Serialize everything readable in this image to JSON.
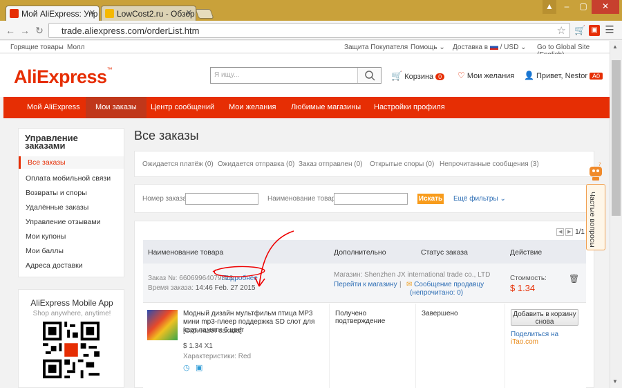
{
  "browser": {
    "tabs": [
      {
        "title": "Мой AliExpress: Упр",
        "icon_color": "#e62e04"
      },
      {
        "title": "LowCost2.ru - Обзор",
        "icon_color": "#f5b800"
      }
    ],
    "url": "trade.aliexpress.com/orderList.htm",
    "window_controls": [
      "–",
      "▢",
      "✕"
    ]
  },
  "topstrip": {
    "hot": "Горящие товары",
    "mall": "Молл",
    "protection": "Защита Покупателя",
    "help": "Помощь",
    "ship_to": "Доставка в",
    "currency": "USD",
    "global_site": "Go to Global Site (English)"
  },
  "header": {
    "logo": "AliExpress",
    "search_placeholder": "Я ищу...",
    "cart_label": "Корзина",
    "cart_count": "0",
    "wishlist_label": "Мои желания",
    "greeting": "Привет, Nestor",
    "user_badge": "A0"
  },
  "nav": {
    "items": [
      "Мой AliExpress",
      "Мои заказы",
      "Центр сообщений",
      "Мои желания",
      "Любимые магазины",
      "Настройки профиля"
    ],
    "active_index": 1
  },
  "sidebar": {
    "title": "Управление заказами",
    "items": [
      "Все заказы",
      "Оплата мобильной связи",
      "Возвраты и споры",
      "Удалённые заказы",
      "Управление отзывами",
      "Мои купоны",
      "Мои баллы",
      "Адреса доставки"
    ],
    "active_index": 0
  },
  "mobile_app": {
    "title": "AliExpress Mobile App",
    "subtitle": "Shop anywhere, anytime!"
  },
  "main": {
    "title": "Все заказы",
    "status_tabs": [
      "Ожидается платёж (0)",
      "Ожидается отправка (0)",
      "Заказ отправлен (0)",
      "Открытые споры (0)",
      "Непрочитанные сообщения (3)"
    ],
    "filters": {
      "order_no_label": "Номер заказа:",
      "product_name_label": "Наименование товара:",
      "search_button": "Искать",
      "more_filters": "Ещё фильтры"
    },
    "pager": "1/1",
    "table_headers": [
      "Наименование товара",
      "Дополнительно",
      "Статус заказа",
      "Действие"
    ],
    "order": {
      "order_no_label": "Заказ №:",
      "order_no": "66069964079323",
      "details_link": "Подробнее",
      "time_label": "Время заказа:",
      "time": "14:46 Feb. 27 2015",
      "store_label": "Магазин:",
      "store": "Shenzhen JX international trade co., LTD",
      "go_to_store": "Перейти к магазину",
      "message_seller": "Сообщение продавцу",
      "unread": "(непрочитано: 0)",
      "cost_label": "Стоимость:",
      "cost": "$ 1.34"
    },
    "product": {
      "title": "Модный дизайн мультфильм птица MP3 мини mp3-плеер поддержка SD слот для карт памяти 6 цвет",
      "snapshot": "[Скриншот заказа]",
      "price_qty": "$ 1.34 X1",
      "attr_label": "Характеристики:",
      "attr_value": "Red",
      "extra": "Получено подтверждение",
      "status": "Завершено",
      "add_to_cart": "Добавить в корзину снова",
      "share_prefix": "Поделиться на",
      "share_site": "iTao.com"
    }
  },
  "faq": {
    "label": "Частые вопросы"
  }
}
